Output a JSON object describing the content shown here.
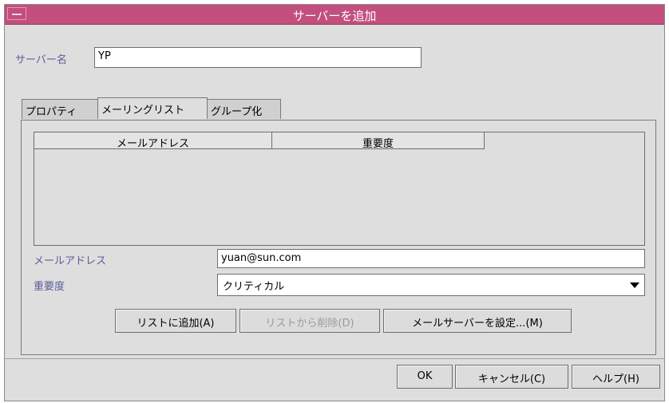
{
  "window": {
    "title": "サーバーを追加"
  },
  "server_name": {
    "label": "サーバー名",
    "value": "YP"
  },
  "tabs": [
    {
      "label": "プロパティ",
      "active": false
    },
    {
      "label": "メーリングリスト",
      "active": true
    },
    {
      "label": "グループ化",
      "active": false
    }
  ],
  "table": {
    "columns": [
      "メールアドレス",
      "重要度"
    ],
    "rows": []
  },
  "form": {
    "email_label": "メールアドレス",
    "email_value": "yuan@sun.com",
    "importance_label": "重要度",
    "importance_value": "クリティカル"
  },
  "buttons": {
    "add_to_list": "リストに追加(A)",
    "remove_from_list": "リストから削除(D)",
    "set_mail_server": "メールサーバーを設定...(M)",
    "ok": "OK",
    "cancel": "キャンセル(C)",
    "help": "ヘルプ(H)"
  },
  "colors": {
    "titlebar": "#c24f7d",
    "label_text": "#5c5c9c",
    "window_bg": "#dedede"
  },
  "icons": {
    "window_menu": "window-menu-icon",
    "dropdown": "chevron-down-icon"
  }
}
